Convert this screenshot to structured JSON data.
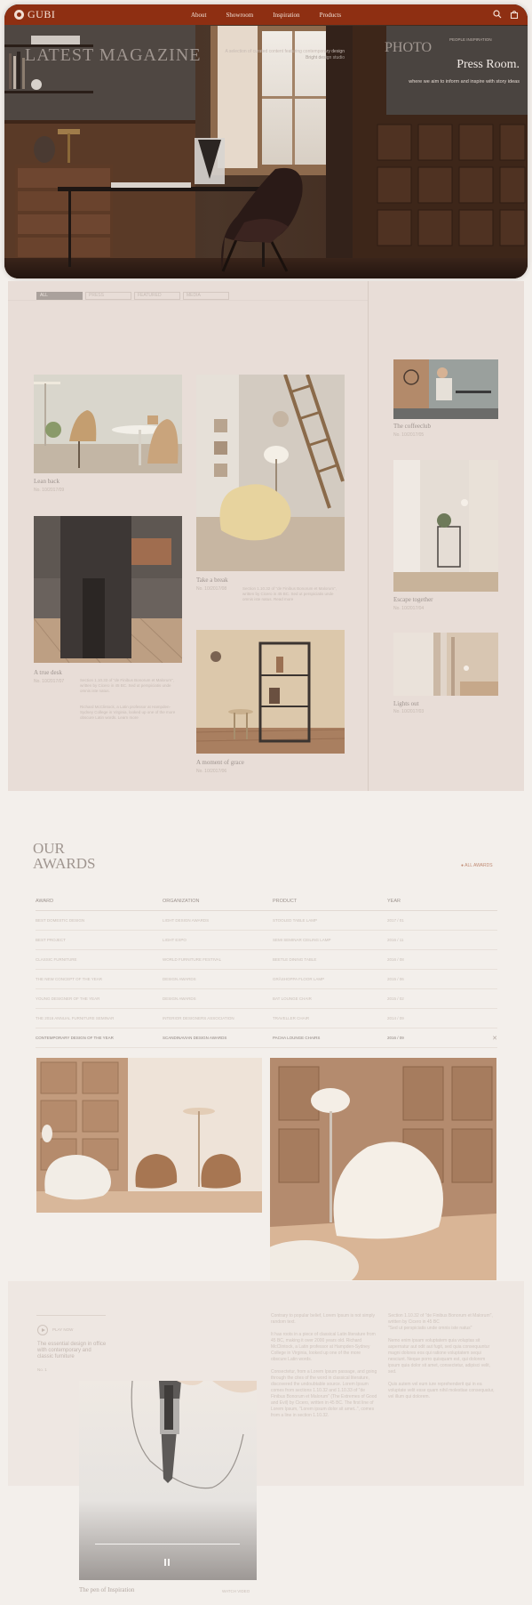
{
  "brand": {
    "name": "GUBI",
    "nav_bg": "#8e2f12"
  },
  "nav": {
    "links": [
      "About",
      "Showroom",
      "Inspiration",
      "Products"
    ],
    "icons": [
      "search-icon",
      "bag-icon"
    ]
  },
  "hero": {
    "title": "Press Room.",
    "subtitle": "where we aim to inform and inspire with story ideas"
  },
  "magazine": {
    "filters": [
      "ALL",
      "PRESS",
      "FEATURED",
      "MEDIA"
    ],
    "title": "LATEST MAGAZINE",
    "intro": "A selection of curated content featuring contemporary design",
    "intro_link": "Bright design studio",
    "cards": [
      {
        "title": "Lean back",
        "number": "No. 10/2017/09",
        "text": ""
      },
      {
        "title": "Take a break",
        "number": "No. 10/2017/08",
        "text": "Section 1.10.32 of \"de Finibus Bonorum et Malorum\", written by Cicero in 45 BC. Sed ut perspiciatis unde omnis iste natus. Read more"
      },
      {
        "title": "A true desk",
        "number": "No. 10/2017/07",
        "text": "Section 1.10.33 of \"de Finibus Bonorum et Malorum\", written by Cicero in 45 BC. Sed ut perspiciatis unde omnis iste natus.",
        "text2": "Richard McClintock, a Latin professor at Hampden-Sydney College in Virginia, looked up one of the more obscure Latin words. Learn more"
      },
      {
        "title": "A moment of grace",
        "number": "No. 10/2017/06",
        "text": ""
      }
    ]
  },
  "photo": {
    "title": "PHOTO",
    "link": "PEOPLE INSPIRATION",
    "cards": [
      {
        "title": "The coffeeclub",
        "number": "No. 10/2017/05"
      },
      {
        "title": "Escape together",
        "number": "No. 10/2017/04"
      },
      {
        "title": "Lights out",
        "number": "No. 10/2017/03"
      }
    ]
  },
  "awards": {
    "title_line1": "OUR",
    "title_line2": "AWARDS",
    "all_link": "ALL AWARDS",
    "columns": [
      "AWARD",
      "ORGANIZATION",
      "PRODUCT",
      "YEAR"
    ],
    "rows": [
      [
        "BEST DOMESTIC DESIGN",
        "LIGHT DESIGN AWARDS",
        "STOOLED TABLE LAMP",
        "2017 / 01"
      ],
      [
        "BEST PROJECT",
        "LIGHT EXPO",
        "SEMI SEMINAR CEILING LAMP",
        "2016 / 11"
      ],
      [
        "CLASSIC FURNITURE",
        "WORLD FURNITURE FESTIVAL",
        "BEETLE DINING TABLE",
        "2016 / 08"
      ],
      [
        "THE NEW CONCEPT OF THE YEAR",
        "DESIGN AWARDS",
        "GRÄSHOPPA FLOOR LAMP",
        "2015 / 06"
      ],
      [
        "YOUNG DESIGNER OF THE YEAR",
        "DESIGN AWARDS",
        "BAT LOUNGE CHAIR",
        "2015 / 02"
      ],
      [
        "THE 2016 ANNUAL FURNITURE SEMINAR",
        "INTERIOR DESIGNERS ASSOCIATION",
        "TRAVELLER CHAIR",
        "2014 / 09"
      ]
    ],
    "open_row": [
      "CONTEMPORARY DESIGN OF THE YEAR",
      "SCANDINAVIAN DESIGN AWARDS",
      "PACHA LOUNGE CHAIRS",
      "2016 / 09"
    ]
  },
  "inspiration": {
    "play_label": "PLAY NOW",
    "intro": "The essential design in office with contemporary and classic furniture",
    "number": "No. 1",
    "col1": "Contrary to popular belief, Lorem Ipsum is not simply random text.\n\nIt has roots in a piece of classical Latin literature from 45 BC, making it over 2000 years old. Richard McClintock, a Latin professor at Hampden-Sydney College in Virginia, looked up one of the more obscure Latin words.\n\nConsectetur, from a Lorem Ipsum passage, and going through the cites of the word in classical literature, discovered the undoubtable source. Lorem Ipsum comes from sections 1.10.32 and 1.10.33 of \"de Finibus Bonorum et Malorum\" (The Extremes of Good and Evil) by Cicero, written in 45 BC. The first line of Lorem Ipsum, \"Lorem ipsum dolor sit amet..\", comes from a line in section 1.10.32.",
    "col2": "Section 1.10.32 of \"de Finibus Bonorum et Malorum\", written by Cicero in 45 BC\n\"Sed ut perspiciatis unde omnis iste natus\"\n\nNemo enim ipsam voluptatem quia voluptas sit aspernatur aut odit aut fugit, sed quia consequuntur magni dolores eos qui ratione voluptatem sequi nesciunt. Neque porro quisquam est, qui dolorem ipsum quia dolor sit amet, consectetur, adipisci velit, sed.\n\nQuis autem vel eum iure reprehenderit qui in ea voluptate velit esse quam nihil molestiae consequatur, vel illum qui dolorem.",
    "video_title": "The pen of Inspiration",
    "video_link": "WATCH VIDEO"
  }
}
